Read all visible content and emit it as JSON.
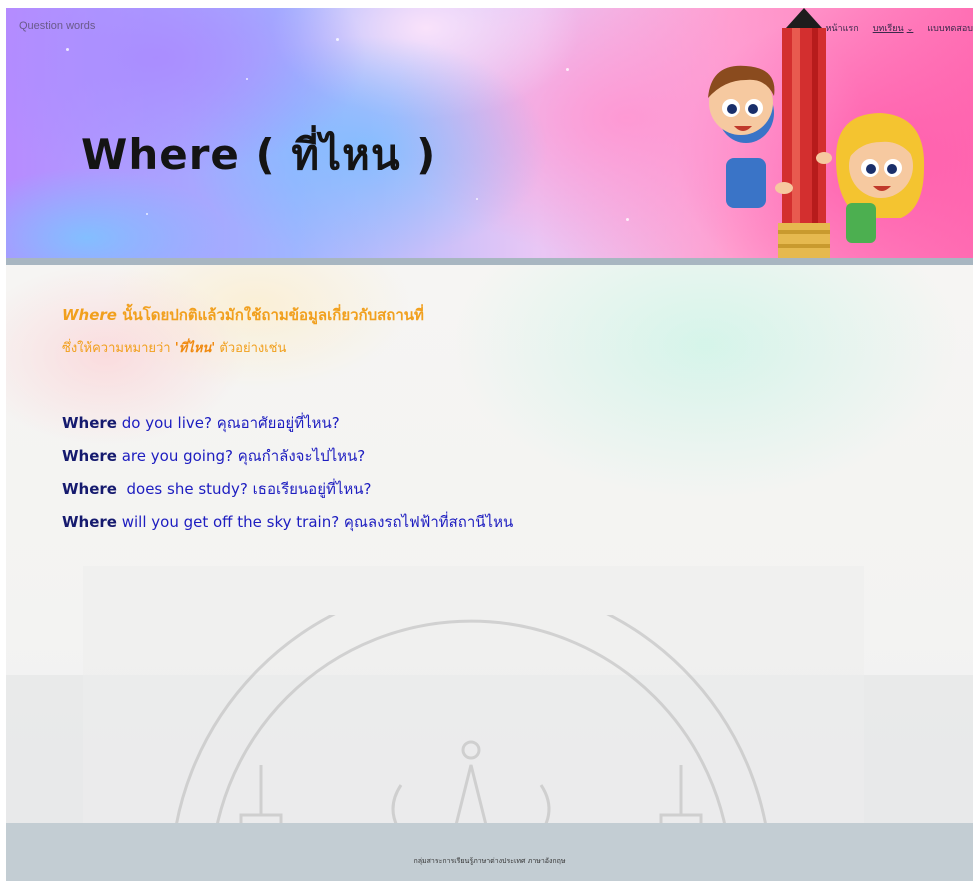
{
  "header": {
    "site_name": "Question words",
    "nav": [
      {
        "label": "หน้าแรก"
      },
      {
        "label": "บทเรียน",
        "has_dropdown": true
      },
      {
        "label": "แบบทดสอบ"
      }
    ],
    "title": "Where ( ที่ไหน )"
  },
  "intro": {
    "line1_keyword": "Where",
    "line1_text": " นั้นโดยปกติแล้วมักใช้ถามข้อมูลเกี่ยวกับสถานที่",
    "line2_prefix": "ซึ่งให้ความหมายว่า ",
    "line2_highlight": "'ที่ไหน'",
    "line2_suffix": " ตัวอย่างเช่น"
  },
  "examples": [
    {
      "keyword": "Where",
      "rest": " do you live? คุณอาศัยอยู่ที่ไหน?"
    },
    {
      "keyword": "Where",
      "rest": " are you going? คุณกำลังจะไปไหน?"
    },
    {
      "keyword": "Where",
      "rest": "  does she study? เธอเรียนอยู่ที่ไหน?"
    },
    {
      "keyword": "Where",
      "rest": " will you get off the sky train? คุณลงรถไฟฟ้าที่สถานีไหน"
    }
  ],
  "footer": {
    "text": "กลุ่มสาระการเรียนรู้ภาษาต่างประเทศ ภาษาอังกฤษ"
  },
  "colors": {
    "intro": "#f1a01e",
    "example_text": "#1d1dc0",
    "keyword": "#151a6e",
    "footer_bar": "#c3cdd3"
  }
}
